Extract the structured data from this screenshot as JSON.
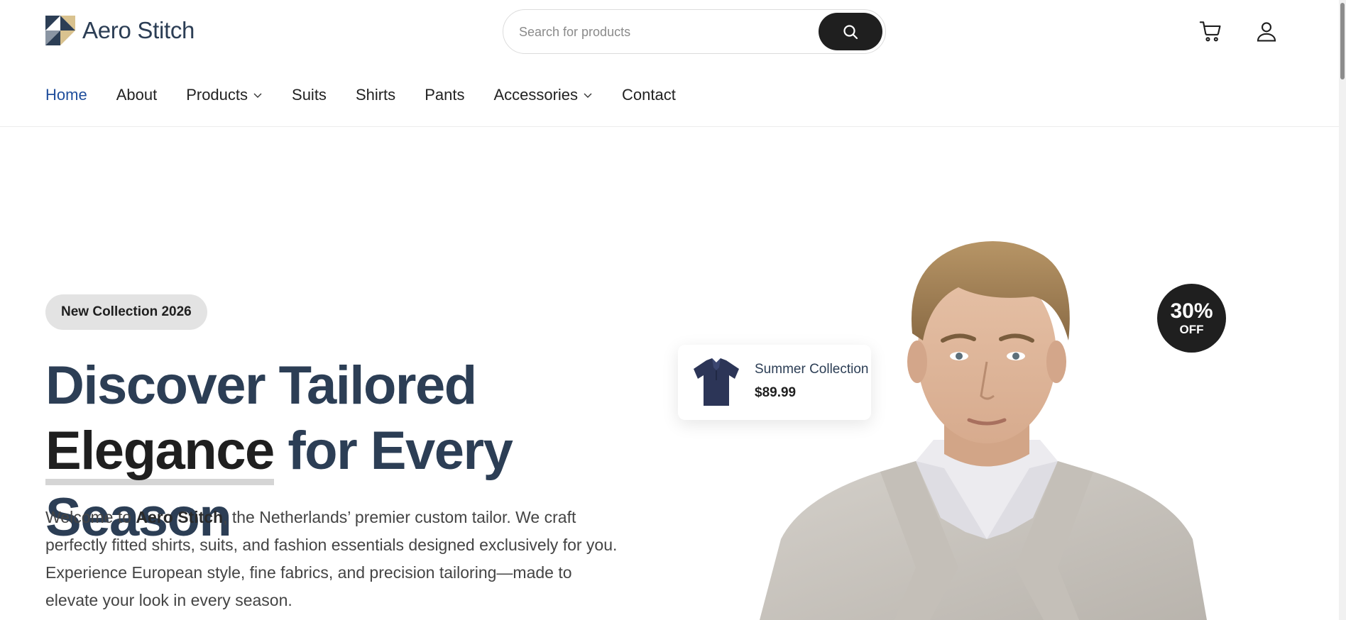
{
  "brand": {
    "name": "Aero Stitch"
  },
  "search": {
    "placeholder": "Search for products",
    "value": ""
  },
  "nav": {
    "items": [
      {
        "label": "Home",
        "active": true,
        "has_dropdown": false
      },
      {
        "label": "About",
        "active": false,
        "has_dropdown": false
      },
      {
        "label": "Products",
        "active": false,
        "has_dropdown": true
      },
      {
        "label": "Suits",
        "active": false,
        "has_dropdown": false
      },
      {
        "label": "Shirts",
        "active": false,
        "has_dropdown": false
      },
      {
        "label": "Pants",
        "active": false,
        "has_dropdown": false
      },
      {
        "label": "Accessories",
        "active": false,
        "has_dropdown": true
      },
      {
        "label": "Contact",
        "active": false,
        "has_dropdown": false
      }
    ]
  },
  "hero": {
    "badge": "New Collection 2026",
    "headline_part1": "Discover Tailored",
    "headline_highlight": "Elegance",
    "headline_part2": " for Every Season",
    "intro_prefix": "Welcome to ",
    "intro_brand": "Aero Stitch",
    "intro_suffix": ", the Netherlands’ premier custom tailor. We craft perfectly fitted shirts, suits, and fashion essentials designed exclusively for you. Experience European style, fine fabrics, and precision tailoring—made to elevate your look in every season."
  },
  "promo_card": {
    "name": "Summer Collection",
    "price": "$89.99"
  },
  "discount": {
    "percent": "30%",
    "label": "OFF"
  },
  "icons": [
    "search-icon",
    "cart-icon",
    "user-icon",
    "chevron-down-icon"
  ],
  "colors": {
    "brand_navy": "#2c3e55",
    "active_link": "#1f4e9c",
    "dark": "#1f1f1f",
    "badge_bg": "#e3e3e3"
  }
}
